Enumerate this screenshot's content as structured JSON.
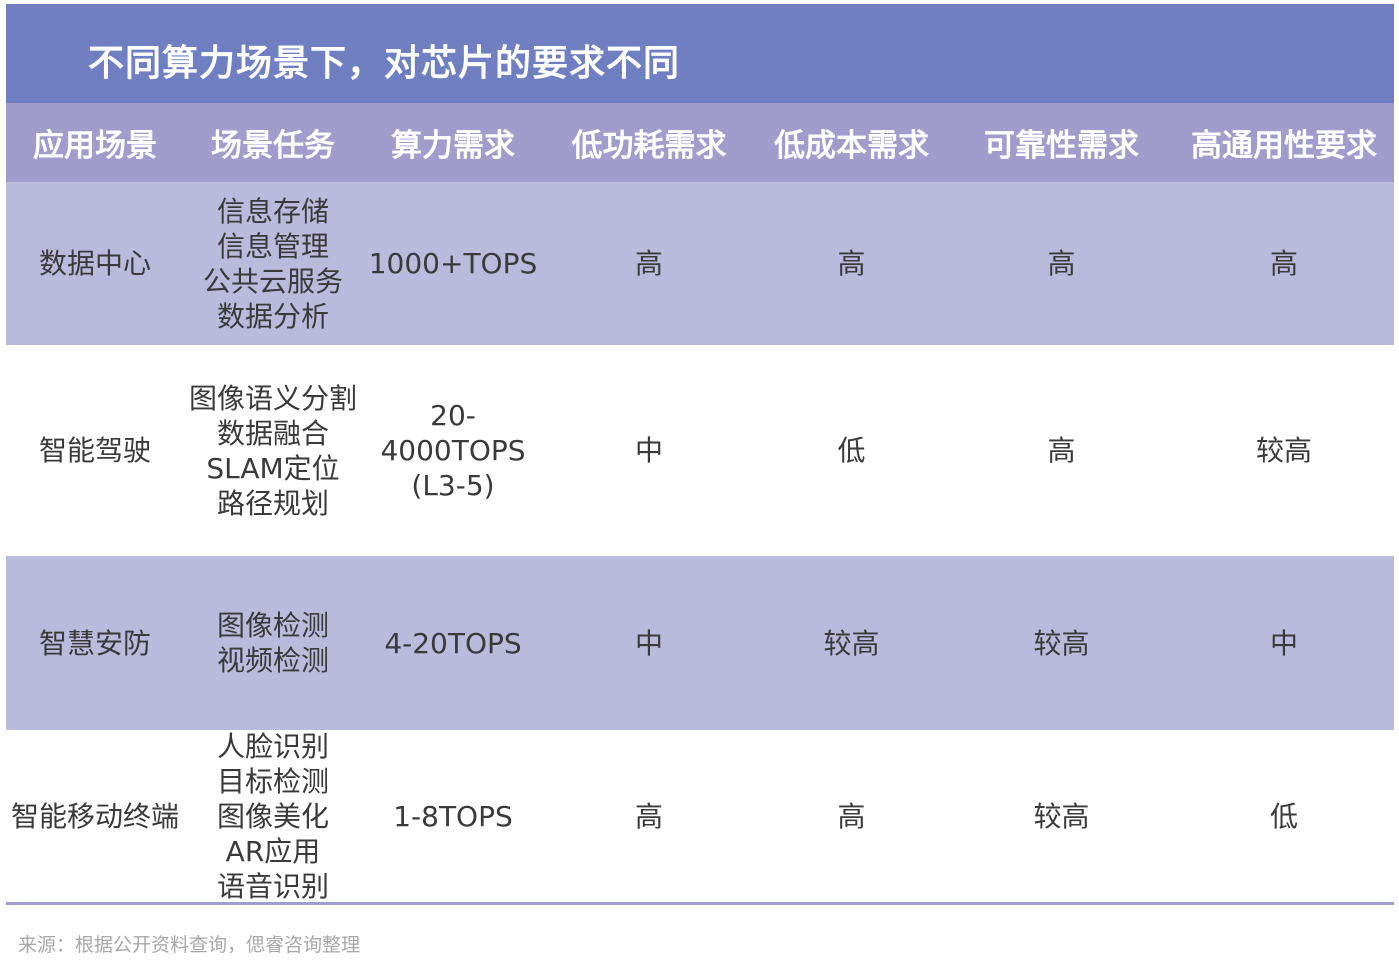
{
  "title": "不同算力场景下，对芯片的要求不同",
  "headers": [
    "应用场景",
    "场景任务",
    "算力需求",
    "低功耗需求",
    "低成本需求",
    "可靠性需求",
    "高通用性要求"
  ],
  "rows": [
    {
      "scene": "数据中心",
      "tasks": [
        "信息存储",
        "信息管理",
        "公共云服务",
        "数据分析"
      ],
      "compute": [
        "1000+TOPS"
      ],
      "low_power": "高",
      "low_cost": "高",
      "reliability": "高",
      "generality": "高"
    },
    {
      "scene": "智能驾驶",
      "tasks": [
        "图像语义分割",
        "数据融合",
        "SLAM定位",
        "路径规划"
      ],
      "compute": [
        "20-",
        "4000TOPS",
        "(L3-5)"
      ],
      "low_power": "中",
      "low_cost": "低",
      "reliability": "高",
      "generality": "较高"
    },
    {
      "scene": "智慧安防",
      "tasks": [
        "图像检测",
        "视频检测"
      ],
      "compute": [
        "4-20TOPS"
      ],
      "low_power": "中",
      "low_cost": "较高",
      "reliability": "较高",
      "generality": "中"
    },
    {
      "scene": "智能移动终端",
      "tasks": [
        "人脸识别",
        "目标检测",
        "图像美化",
        "AR应用",
        "语音识别"
      ],
      "compute": [
        "1-8TOPS"
      ],
      "low_power": "高",
      "low_cost": "高",
      "reliability": "较高",
      "generality": "低"
    }
  ],
  "source": "来源：根据公开资料查询，偲睿咨询整理",
  "colors": {
    "banner": "#6f7fc2",
    "header": "#a09dcd",
    "shaded_row": "#babbdc",
    "text": "#3a3a3a"
  }
}
